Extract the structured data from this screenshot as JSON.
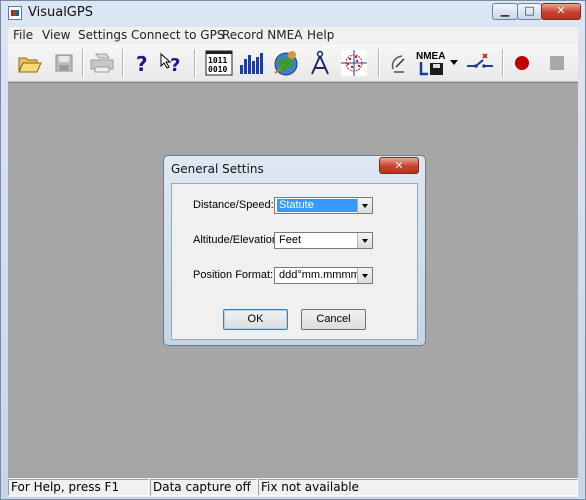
{
  "window": {
    "title": "VisualGPS"
  },
  "caption_buttons": {
    "minimize": "▁",
    "maximize": "□",
    "close": "✕"
  },
  "menu": [
    "File",
    "View",
    "Settings",
    "Connect to GPS",
    "Record NMEA",
    "Help"
  ],
  "toolbar": {
    "icons": [
      "open-folder-icon",
      "save-icon",
      "print-icon",
      "help-icon",
      "context-help-icon",
      "binary-data-icon",
      "signal-strength-icon",
      "globe-icon",
      "compass-icon",
      "scatter-plot-icon",
      "satellite-dish-icon",
      "nmea-record-icon",
      "connect-icon",
      "record-icon",
      "stop-icon"
    ],
    "binary_top": "1011",
    "binary_bottom": "0010",
    "nmea_label": "NMEA"
  },
  "status": {
    "help": "For Help, press F1",
    "capture": "Data capture off",
    "fix": "Fix not available"
  },
  "dialog": {
    "title": "General Settins",
    "distance_label": "Distance/Speed:",
    "distance_value": "Statute",
    "altitude_label": "Altitude/Elevation:",
    "altitude_value": "Feet",
    "position_label": "Position Format:",
    "position_value": "ddd°mm.mmmm",
    "ok": "OK",
    "cancel": "Cancel"
  },
  "colors": {
    "client_bg": "#a6a6a6",
    "selection": "#3399ff",
    "record": "#c00000"
  }
}
